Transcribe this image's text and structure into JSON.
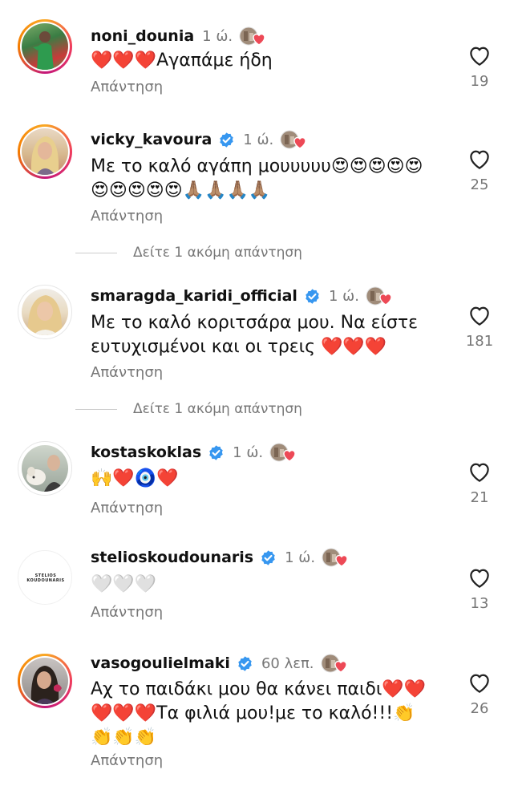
{
  "comments": [
    {
      "username": "noni_dounia",
      "verified": false,
      "time": "1 ώ.",
      "text": "❤️❤️❤️Αγαπάμε ήδη",
      "reply": "Απάντηση",
      "likes": "19"
    },
    {
      "username": "vicky_kavoura",
      "verified": true,
      "time": "1 ώ.",
      "text": "Με το καλό αγάπη μουυυυυ😍😍😍😍😍😍😍😍😍😍🙏🏽🙏🏽🙏🏽🙏🏽",
      "reply": "Απάντηση",
      "likes": "25",
      "more_replies": "Δείτε 1 ακόμη απάντηση"
    },
    {
      "username": "smaragda_karidi_official",
      "verified": true,
      "time": "1 ώ.",
      "text": "Με το καλό κοριτσάρα μου. Να είστε ευτυχισμένοι και οι τρεις ❤️❤️❤️",
      "reply": "Απάντηση",
      "likes": "181",
      "more_replies": "Δείτε 1 ακόμη απάντηση"
    },
    {
      "username": "kostaskoklas",
      "verified": true,
      "time": "1 ώ.",
      "text": "🙌❤️🧿❤️",
      "reply": "Απάντηση",
      "likes": "21"
    },
    {
      "username": "stelioskoudounaris",
      "verified": true,
      "time": "1 ώ.",
      "avatar_text": "STELIOS KOUDOUNARIS",
      "text": "🤍🤍🤍",
      "reply": "Απάντηση",
      "likes": "13"
    },
    {
      "username": "vasogoulielmaki",
      "verified": true,
      "time": "60 λεπ.",
      "text": "Αχ το παιδάκι μου θα κάνει παιδι❤️❤️❤️❤️❤️Τα φιλιά μου!με το καλό!!!👏👏👏👏",
      "reply": "Απάντηση",
      "likes": "26"
    }
  ],
  "colors": {
    "text": "#111111",
    "secondary": "#777777",
    "verified": "#3797f0",
    "liked_heart": "#ed4956"
  }
}
